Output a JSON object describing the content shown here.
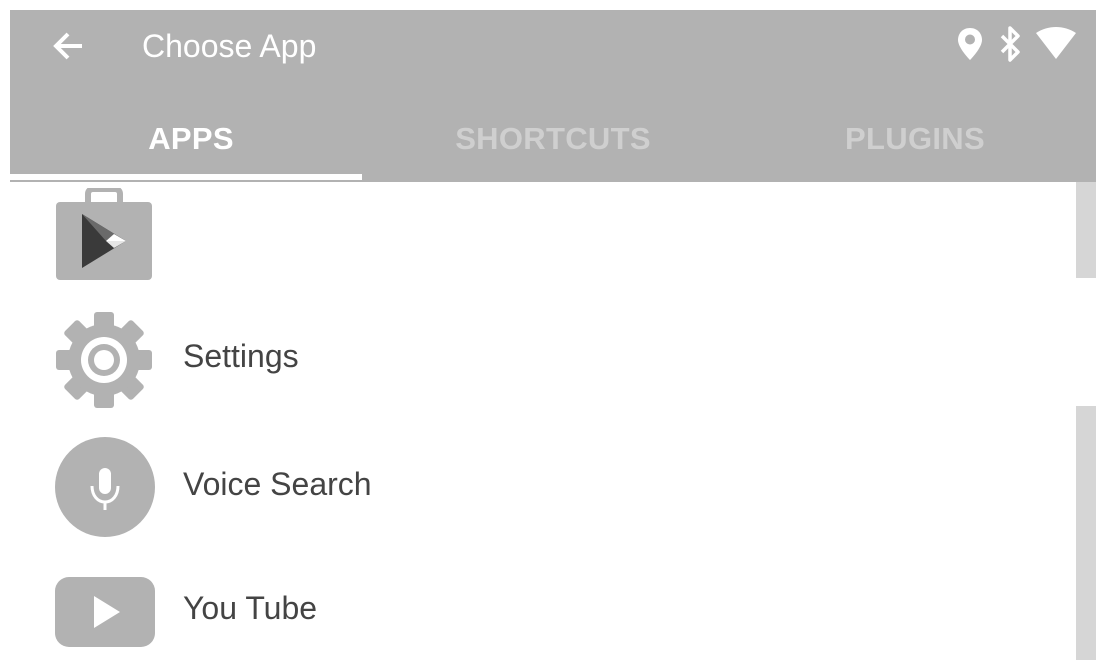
{
  "appbar": {
    "title": "Choose App",
    "background_color": "#b2b2b2",
    "back_icon": "arrow-left-icon",
    "status_icons": [
      "location-pin-icon",
      "bluetooth-icon",
      "wifi-icon"
    ]
  },
  "tabs": [
    {
      "label": "APPS",
      "active": true
    },
    {
      "label": "SHORTCUTS",
      "active": false
    },
    {
      "label": "PLUGINS",
      "active": false
    }
  ],
  "apps": [
    {
      "label": "",
      "icon": "play-store-icon"
    },
    {
      "label": "Settings",
      "icon": "gear-icon"
    },
    {
      "label": "Voice Search",
      "icon": "microphone-icon"
    },
    {
      "label": "You Tube",
      "icon": "youtube-play-icon"
    }
  ],
  "colors": {
    "icon_gray": "#b2b2b2",
    "label_text": "#444444",
    "inactive_tab_text": "#cfcfcf",
    "active_tab_text": "#ffffff",
    "scrollbar": "#d6d6d6"
  }
}
